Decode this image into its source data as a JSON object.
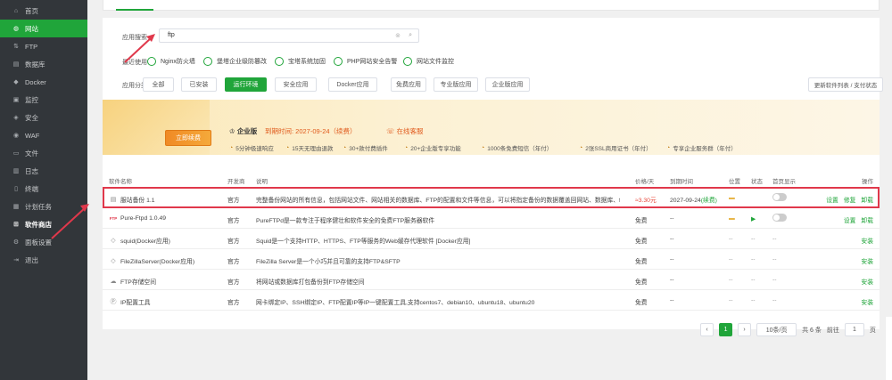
{
  "sidebar": {
    "items": [
      {
        "label": "首页",
        "icon": "home-icon",
        "glyph": "⌂"
      },
      {
        "label": "网站",
        "icon": "globe-icon",
        "glyph": "◍"
      },
      {
        "label": "FTP",
        "icon": "ftp-icon",
        "glyph": "⇅"
      },
      {
        "label": "数据库",
        "icon": "database-icon",
        "glyph": "▤"
      },
      {
        "label": "Docker",
        "icon": "docker-icon",
        "glyph": "◆"
      },
      {
        "label": "监控",
        "icon": "monitor-icon",
        "glyph": "▣"
      },
      {
        "label": "安全",
        "icon": "shield-icon",
        "glyph": "◈"
      },
      {
        "label": "WAF",
        "icon": "waf-icon",
        "glyph": "◉"
      },
      {
        "label": "文件",
        "icon": "folder-icon",
        "glyph": "▭"
      },
      {
        "label": "日志",
        "icon": "log-icon",
        "glyph": "▥"
      },
      {
        "label": "终端",
        "icon": "terminal-icon",
        "glyph": "▯"
      },
      {
        "label": "计划任务",
        "icon": "calendar-icon",
        "glyph": "▦"
      },
      {
        "label": "软件商店",
        "icon": "grid-icon",
        "glyph": "⊞"
      },
      {
        "label": "面板设置",
        "icon": "gear-icon",
        "glyph": "⚙"
      },
      {
        "label": "退出",
        "icon": "logout-icon",
        "glyph": "⇥"
      }
    ]
  },
  "search": {
    "label": "应用搜索",
    "value": "ftp"
  },
  "recent": {
    "label": "最近使用",
    "items": [
      "Nginx防火墙",
      "堡塔企业级防篡改",
      "宝塔系统加固",
      "PHP网站安全告警",
      "网站文件监控"
    ]
  },
  "categories": {
    "label": "应用分类",
    "items": [
      "全部",
      "已安装",
      "运行环境",
      "安全应用",
      "Docker应用",
      "免费应用",
      "专业版应用",
      "企业版应用"
    ],
    "update_label": "更新软件列表 / 支付状态"
  },
  "banner": {
    "renew_label": "立即续费",
    "edition": "企业版",
    "expire": "到期时间: 2027-09-24（续费）",
    "support": "在线客服",
    "features": [
      "5分钟极速响应",
      "15天无理由退款",
      "30+款付费插件",
      "20+企业版专享功能",
      "1000条免费短信（年付）",
      "2张SSL商用证书（年付）",
      "专享企业服务群（年付）"
    ]
  },
  "table": {
    "headers": [
      "软件名称",
      "开发商",
      "说明",
      "价格/天",
      "到期时间",
      "位置",
      "状态",
      "首页显示",
      "操作"
    ],
    "rows": [
      {
        "name": "服站备份 1.1",
        "icon": "backup-icon",
        "dev": "官方",
        "desc": "完整备份网站的所有信息，包括网站文件、网站相关的数据库、FTP的配置和文件等信息，可以将指定备份的数据覆盖回网站、数据库、ftp。",
        "price": "≈3.30元",
        "expiry": "2027-09-24",
        "expiry_renew": "(续费)",
        "loc": "▬",
        "status": "",
        "ops": [
          "设置",
          "修复",
          "卸载"
        ]
      },
      {
        "name": "Pure-Ftpd 1.0.49",
        "icon": "ftp-logo-icon",
        "dev": "官方",
        "desc": "PureFTPd是一款专注于程序健壮和软件安全的免费FTP服务器软件",
        "price": "免费",
        "expiry": "--",
        "expiry_renew": "",
        "loc": "▬",
        "status": "▶",
        "ops": [
          "设置",
          "卸载"
        ]
      },
      {
        "name": "squid(Docker应用)",
        "icon": "cube-icon",
        "dev": "官方",
        "desc": "Squid是一个支持HTTP、HTTPS、FTP等服务的Web缓存代理软件 [Docker应用]",
        "price": "免费",
        "expiry": "--",
        "expiry_renew": "",
        "loc": "--",
        "status": "--",
        "ops": [
          "安装"
        ]
      },
      {
        "name": "FileZillaServer(Docker应用)",
        "icon": "cube-icon",
        "dev": "官方",
        "desc": "FileZilla Server是一个小巧并且可靠的支持FTP&SFTP",
        "price": "免费",
        "expiry": "--",
        "expiry_renew": "",
        "loc": "--",
        "status": "--",
        "ops": [
          "安装"
        ]
      },
      {
        "name": "FTP存储空间",
        "icon": "cloud-icon",
        "dev": "官方",
        "desc": "将网站或数据库打包备份到FTP存储空间",
        "price": "免费",
        "expiry": "--",
        "expiry_renew": "",
        "loc": "--",
        "status": "--",
        "ops": [
          "安装"
        ]
      },
      {
        "name": "IP配置工具",
        "icon": "ip-icon",
        "dev": "官方",
        "desc": "网卡绑定IP、SSH绑定IP、FTP配置IP等IP一键配置工具,支持centos7、debian10、ubuntu18、ubuntu20",
        "price": "免费",
        "expiry": "--",
        "expiry_renew": "",
        "loc": "--",
        "status": "--",
        "ops": [
          "安装"
        ]
      }
    ]
  },
  "pager": {
    "prev": "‹",
    "current": "1",
    "next": "›",
    "per_page": "10条/页",
    "total": "共 6 条",
    "goto_label": "前往",
    "goto_value": "1",
    "page_unit": "页"
  },
  "colors": {
    "accent": "#20a53a",
    "sidebar": "#32363a",
    "highlight": "#e0384b",
    "price": "#e8483b"
  }
}
